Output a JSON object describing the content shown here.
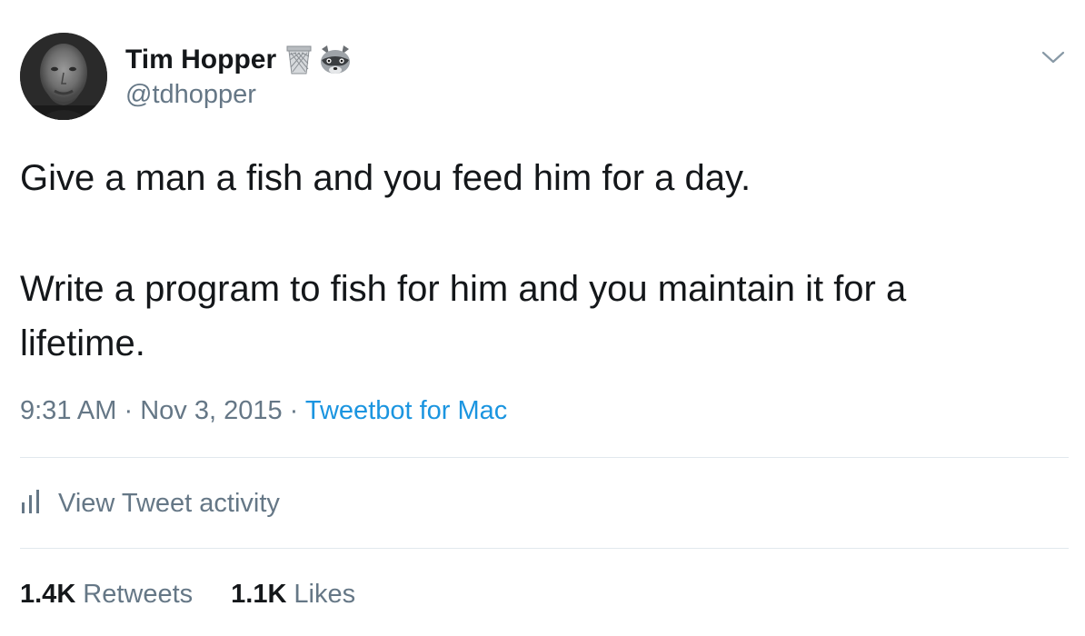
{
  "author": {
    "display_name": "Tim Hopper",
    "handle": "@tdhopper",
    "name_emojis": [
      "wastebasket-icon",
      "raccoon-icon"
    ]
  },
  "tweet": {
    "paragraphs": [
      "Give a man a fish and you feed him for a day.",
      "Write a program to fish for him and you maintain it for a lifetime."
    ],
    "time": "9:31 AM",
    "separator": "·",
    "date": "Nov 3, 2015",
    "source": "Tweetbot for Mac"
  },
  "activity": {
    "label": "View Tweet activity",
    "icon": "bar-chart-icon"
  },
  "stats": {
    "retweets_count": "1.4K",
    "retweets_label": "Retweets",
    "likes_count": "1.1K",
    "likes_label": "Likes"
  },
  "colors": {
    "text_primary": "#14171a",
    "text_secondary": "#657786",
    "link": "#1b95e0",
    "divider": "#e1e8ed"
  }
}
